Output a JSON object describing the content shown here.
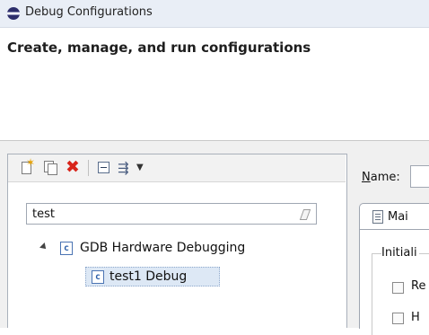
{
  "window": {
    "title": "Debug Configurations",
    "app_icon": "eclipse-icon"
  },
  "header": {
    "title": "Create, manage, and run configurations"
  },
  "toolbar": {
    "buttons": [
      {
        "name": "new-configuration",
        "icon": "new-config-icon"
      },
      {
        "name": "duplicate-configuration",
        "icon": "duplicate-icon"
      },
      {
        "name": "delete-configuration",
        "icon": "delete-icon"
      },
      {
        "name": "collapse-all",
        "icon": "collapse-all-icon"
      },
      {
        "name": "filter-configurations",
        "icon": "filter-icon"
      },
      {
        "name": "view-menu",
        "icon": "view-menu-icon"
      }
    ]
  },
  "search": {
    "value": "test",
    "clear_icon": "clear-search-icon"
  },
  "tree": {
    "items": [
      {
        "label": "GDB Hardware Debugging",
        "icon": "c-launch-type-icon",
        "expanded": true
      },
      {
        "label": "test1 Debug",
        "icon": "c-config-icon",
        "selected": true
      }
    ]
  },
  "config": {
    "name_label_mnemonic": "N",
    "name_label_rest": "ame:",
    "name_value": "",
    "tabs": [
      {
        "label": "Mai",
        "icon": "main-tab-icon",
        "active": true
      }
    ],
    "group_label": "Initiali",
    "checkboxes": [
      {
        "label": "Re",
        "checked": false
      },
      {
        "label": "H",
        "checked": false
      }
    ]
  },
  "colors": {
    "titlebar_bg": "#e9eef6",
    "panel_bg": "#f0f0f0",
    "selection_bg": "#dde8f5",
    "delete_red": "#d8241a"
  }
}
